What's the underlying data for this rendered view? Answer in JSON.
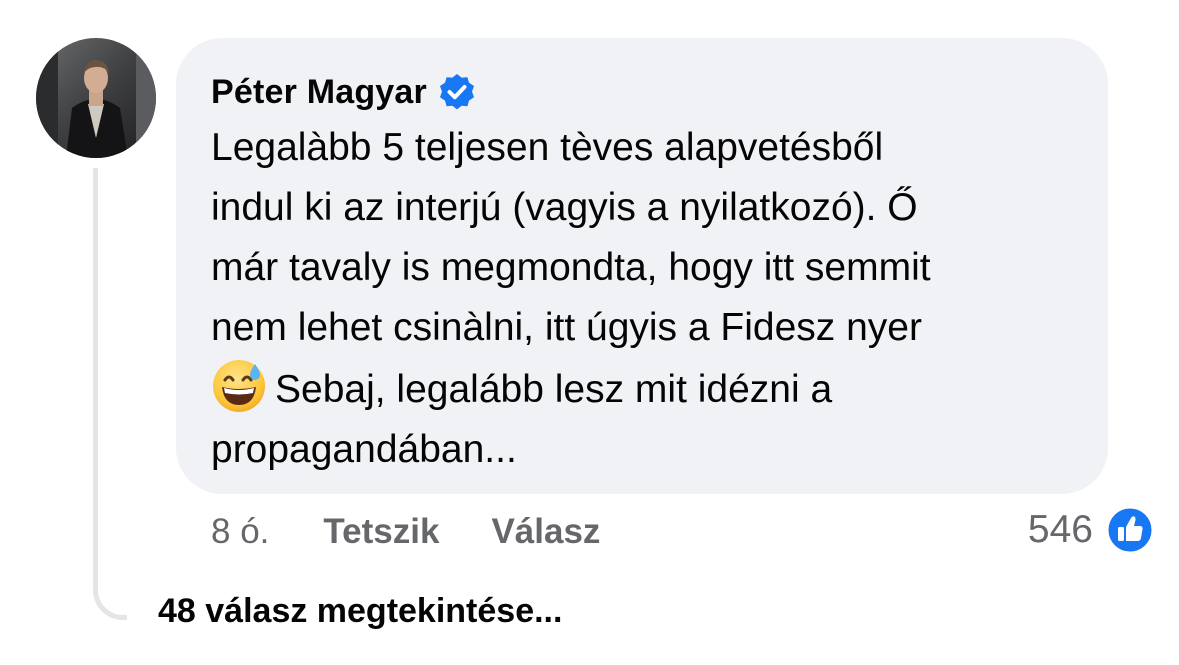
{
  "comment": {
    "author": "Péter Magyar",
    "author_verified": true,
    "avatar_icon": "profile-photo",
    "text_lines": [
      "Legalàbb 5 teljesen tèves alapvetésből",
      "indul ki az interjú (vagyis a nyilatkozó). Ő",
      "már tavaly is megmondta, hogy itt semmit",
      "nem lehet csinàlni, itt úgyis a Fidesz nyer",
      "Sebaj, legalább lesz mit idézni a",
      "propagandában..."
    ],
    "emoji_icon": "grinning-face-with-sweat-emoji",
    "time": "8 ó.",
    "like_label": "Tetszik",
    "reply_label": "Válasz",
    "reaction_count": "546",
    "reaction_icon": "like-thumbs-up-icon"
  },
  "replies": {
    "view_label": "48 válasz megtekintése..."
  },
  "colors": {
    "bubble_bg": "#f0f2f5",
    "verified_blue": "#1877f2",
    "secondary_text": "#65676b",
    "thread_line": "#e3e5e9"
  }
}
